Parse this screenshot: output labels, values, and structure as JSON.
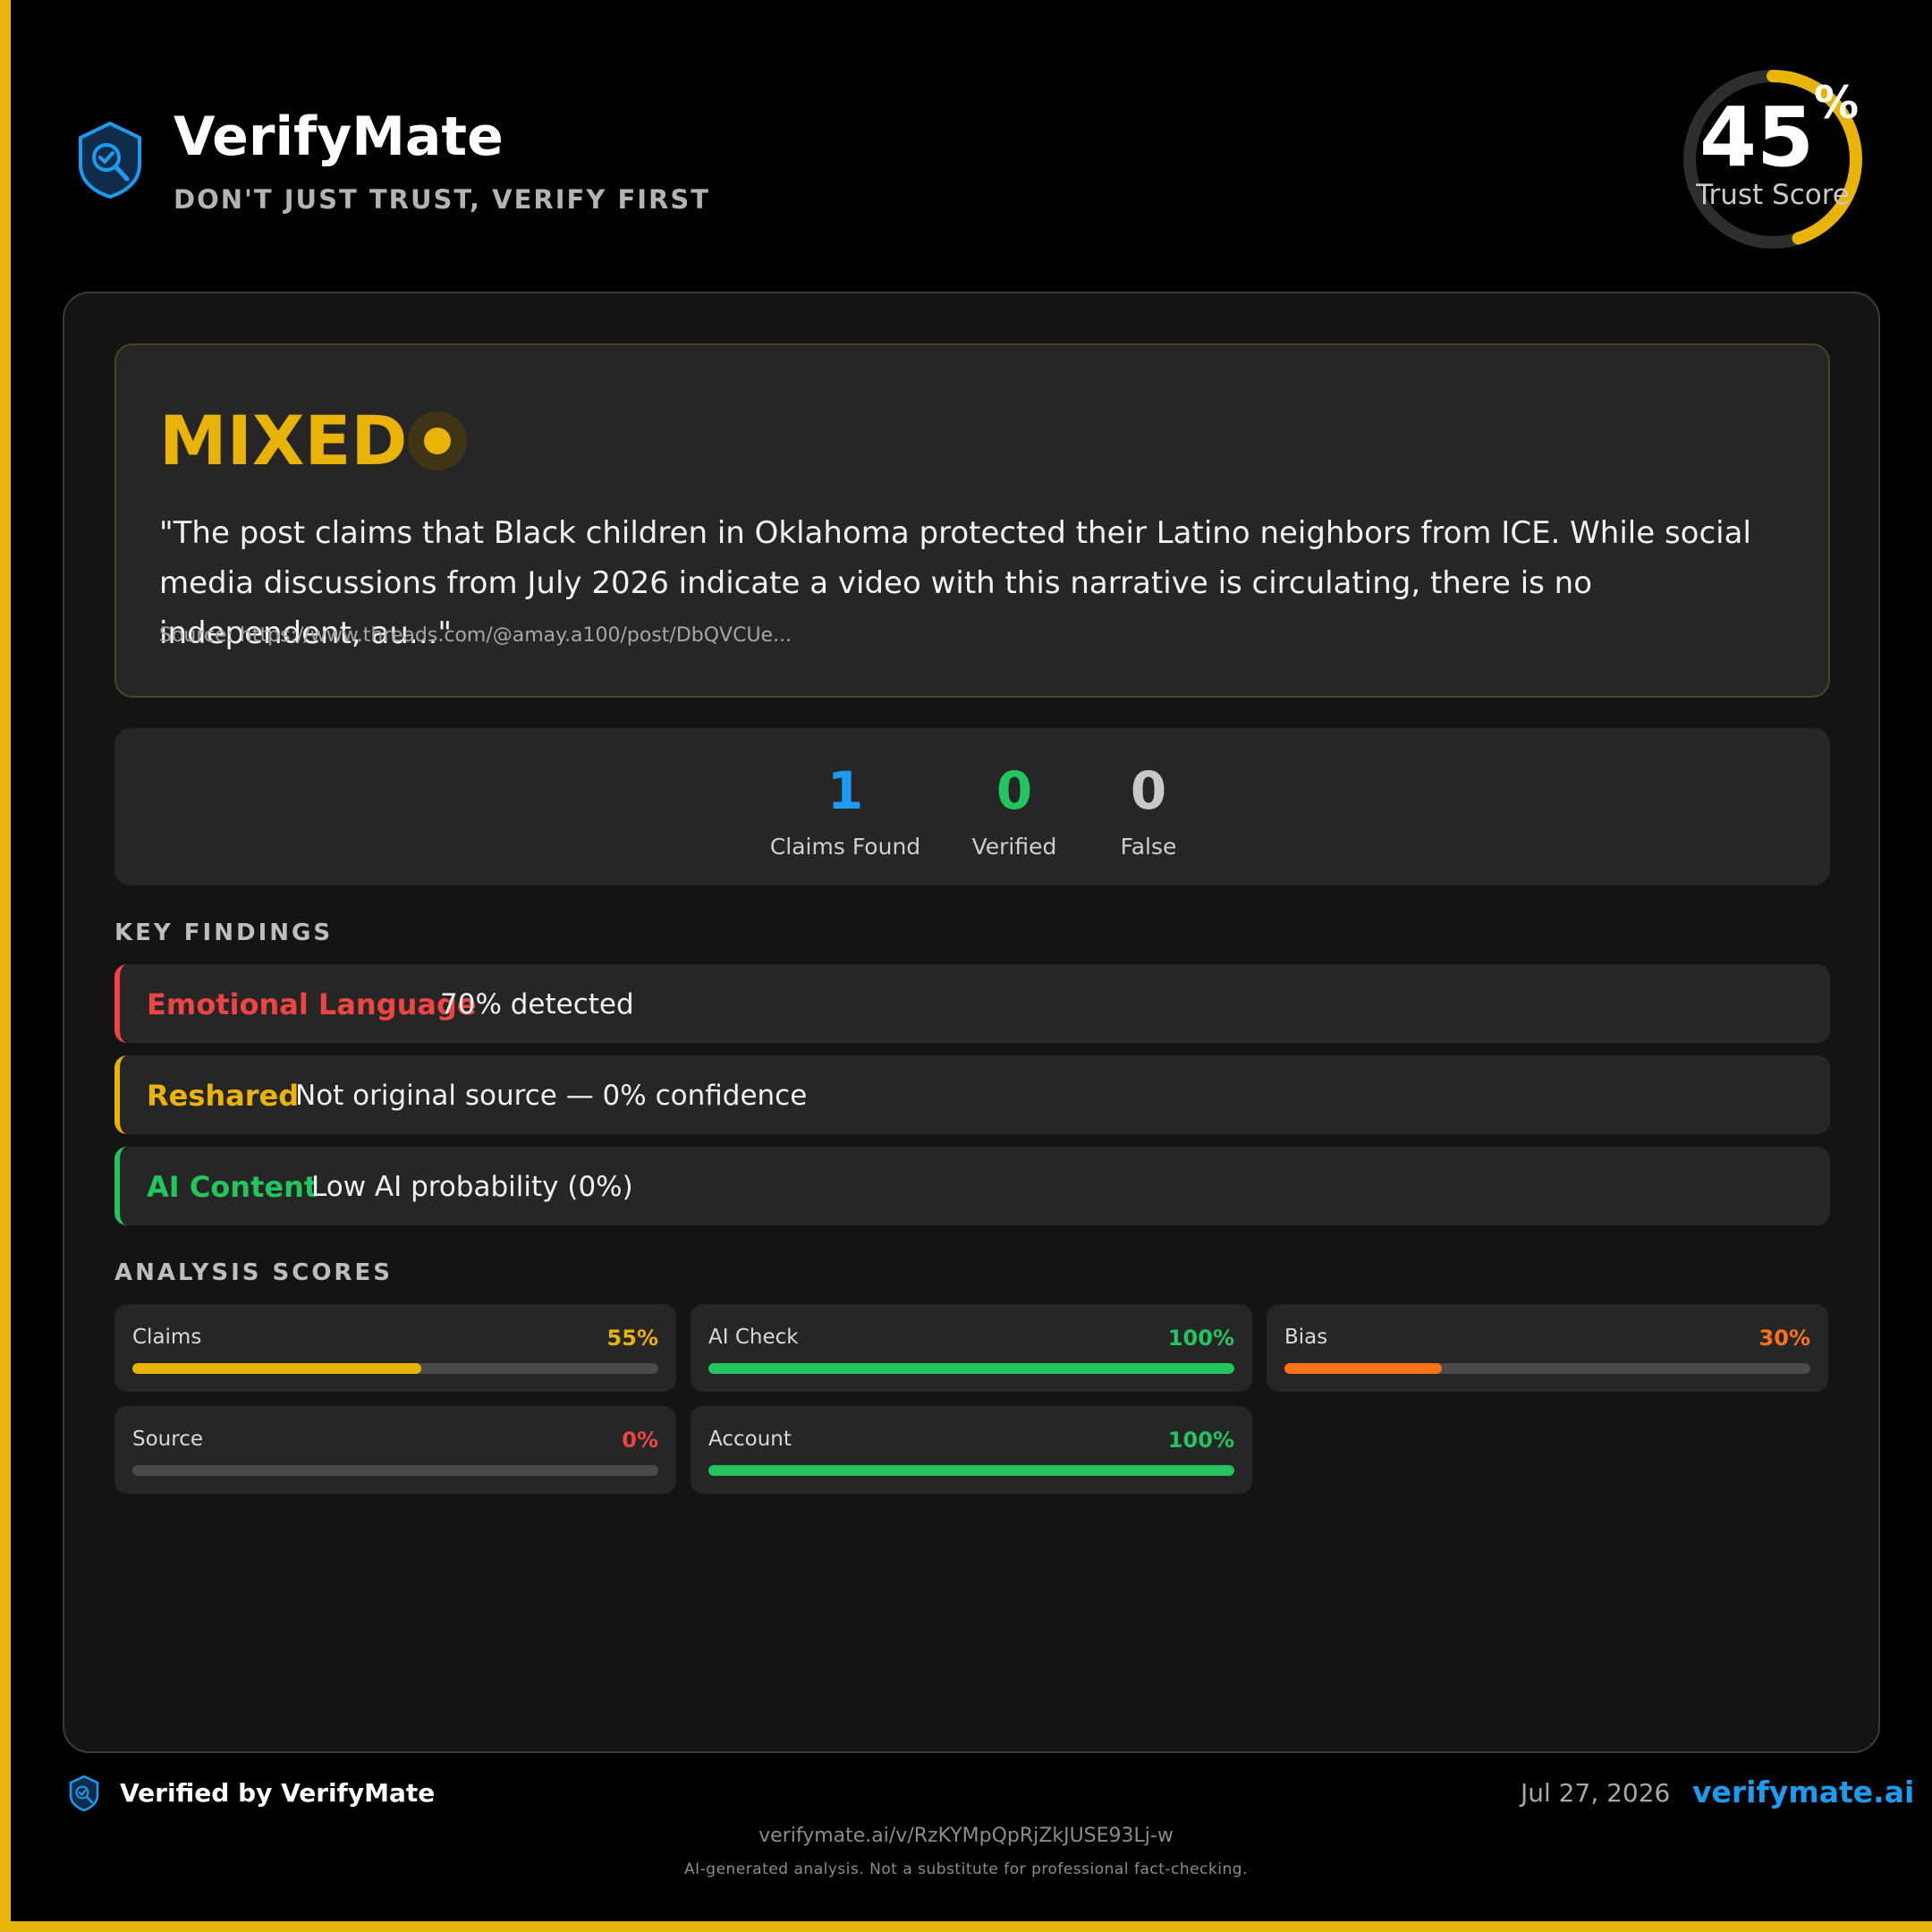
{
  "brand": {
    "title": "VerifyMate",
    "tagline": "DON'T JUST TRUST, VERIFY FIRST",
    "icon": "shield-check-icon",
    "accent": "#1d9bf0"
  },
  "trust_score": {
    "value": "45",
    "unit": "%",
    "fraction": 0.45,
    "label": "Trust Score",
    "color": "#eab308"
  },
  "verdict": {
    "label": "MIXED",
    "color": "#eab308",
    "summary": "\"The post claims that Black children in Oklahoma protected their Latino neighbors from ICE. While social media discussions from July 2026 indicate a video with this narrative is circulating, there is no independent, au...\"",
    "source": "Source: https://www.threads.com/@amay.a100/post/DbQVCUe..."
  },
  "stats": [
    {
      "value": "1",
      "label": "Claims Found",
      "color": "#1d9bf0"
    },
    {
      "value": "0",
      "label": "Verified",
      "color": "#22c55e"
    },
    {
      "value": "0",
      "label": "False",
      "color": "#c9c9c9"
    }
  ],
  "key_findings": {
    "title": "KEY FINDINGS",
    "items": [
      {
        "title": "Emotional Language",
        "description": "70% detected",
        "color": "#ef4444"
      },
      {
        "title": "Reshared",
        "description": "Not original source — 0% confidence",
        "color": "#eab308"
      },
      {
        "title": "AI Content",
        "description": "Low AI probability (0%)",
        "color": "#22c55e"
      }
    ]
  },
  "analysis_scores": {
    "title": "ANALYSIS SCORES",
    "items": [
      {
        "label": "Claims",
        "value": "55%",
        "fraction": 0.55,
        "color": "#eab308"
      },
      {
        "label": "AI Check",
        "value": "100%",
        "fraction": 1.0,
        "color": "#22c55e"
      },
      {
        "label": "Bias",
        "value": "30%",
        "fraction": 0.3,
        "color": "#f97316"
      },
      {
        "label": "Source",
        "value": "0%",
        "fraction": 0.0,
        "color": "#ef4444"
      },
      {
        "label": "Account",
        "value": "100%",
        "fraction": 1.0,
        "color": "#22c55e"
      }
    ]
  },
  "footer": {
    "verified_by": "Verified by VerifyMate",
    "date": "Jul 27, 2026",
    "site": "verifymate.ai",
    "url": "verifymate.ai/v/RzKYMpQpRjZkJUSE93Lj-w",
    "disclaimer": "AI-generated analysis. Not a substitute for professional fact-checking."
  }
}
